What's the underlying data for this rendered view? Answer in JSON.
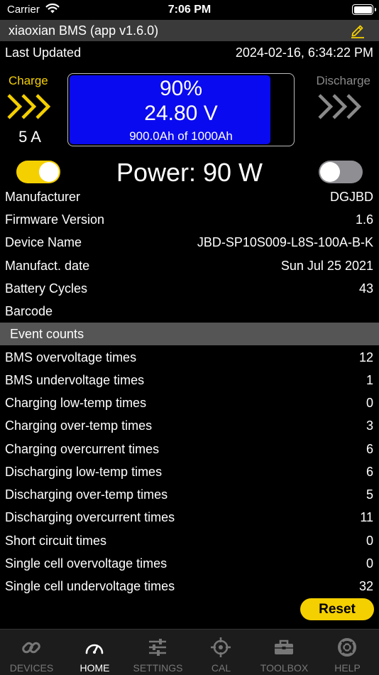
{
  "status": {
    "carrier": "Carrier",
    "time": "7:06 PM"
  },
  "header": {
    "title": "xiaoxian BMS (app v1.6.0)"
  },
  "last_updated": {
    "label": "Last Updated",
    "value": "2024-02-16, 6:34:22 PM"
  },
  "charge": {
    "label": "Charge",
    "current": "5 A",
    "enabled": true
  },
  "discharge": {
    "label": "Discharge",
    "enabled": false
  },
  "battery": {
    "percent_text": "90%",
    "percent": 90,
    "voltage": "24.80 V",
    "capacity": "900.0Ah of 1000Ah"
  },
  "power": "Power: 90 W",
  "info": [
    {
      "label": "Manufacturer",
      "value": "DGJBD"
    },
    {
      "label": "Firmware Version",
      "value": "1.6"
    },
    {
      "label": "Device Name",
      "value": "JBD-SP10S009-L8S-100A-B-K"
    },
    {
      "label": "Manufact. date",
      "value": "Sun Jul 25 2021"
    },
    {
      "label": "Battery Cycles",
      "value": "43"
    },
    {
      "label": "Barcode",
      "value": ""
    }
  ],
  "events": {
    "header": "Event counts",
    "items": [
      {
        "label": "BMS overvoltage times",
        "value": "12"
      },
      {
        "label": "BMS undervoltage times",
        "value": "1"
      },
      {
        "label": "Charging low-temp times",
        "value": "0"
      },
      {
        "label": "Charging over-temp times",
        "value": "3"
      },
      {
        "label": "Charging overcurrent times",
        "value": "6"
      },
      {
        "label": "Discharging low-temp times",
        "value": "6"
      },
      {
        "label": "Discharging over-temp times",
        "value": "5"
      },
      {
        "label": "Discharging overcurrent times",
        "value": "11"
      },
      {
        "label": "Short circuit times",
        "value": "0"
      },
      {
        "label": "Single cell overvoltage times",
        "value": "0"
      },
      {
        "label": "Single cell undervoltage times",
        "value": "32"
      }
    ],
    "reset_label": "Reset"
  },
  "tabs": [
    {
      "label": "DEVICES",
      "icon": "link-icon",
      "active": false
    },
    {
      "label": "HOME",
      "icon": "gauge-icon",
      "active": true
    },
    {
      "label": "SETTINGS",
      "icon": "sliders-icon",
      "active": false
    },
    {
      "label": "CAL",
      "icon": "crosshair-icon",
      "active": false
    },
    {
      "label": "TOOLBOX",
      "icon": "toolbox-icon",
      "active": false
    },
    {
      "label": "HELP",
      "icon": "lifebuoy-icon",
      "active": false
    }
  ],
  "colors": {
    "accent": "#f5d000",
    "battery_fill": "#0a0af0",
    "toggle_off": "#8e8e93",
    "inactive": "#8a8a8a",
    "title_bar": "#3a3a3a",
    "section_header": "#555555"
  }
}
